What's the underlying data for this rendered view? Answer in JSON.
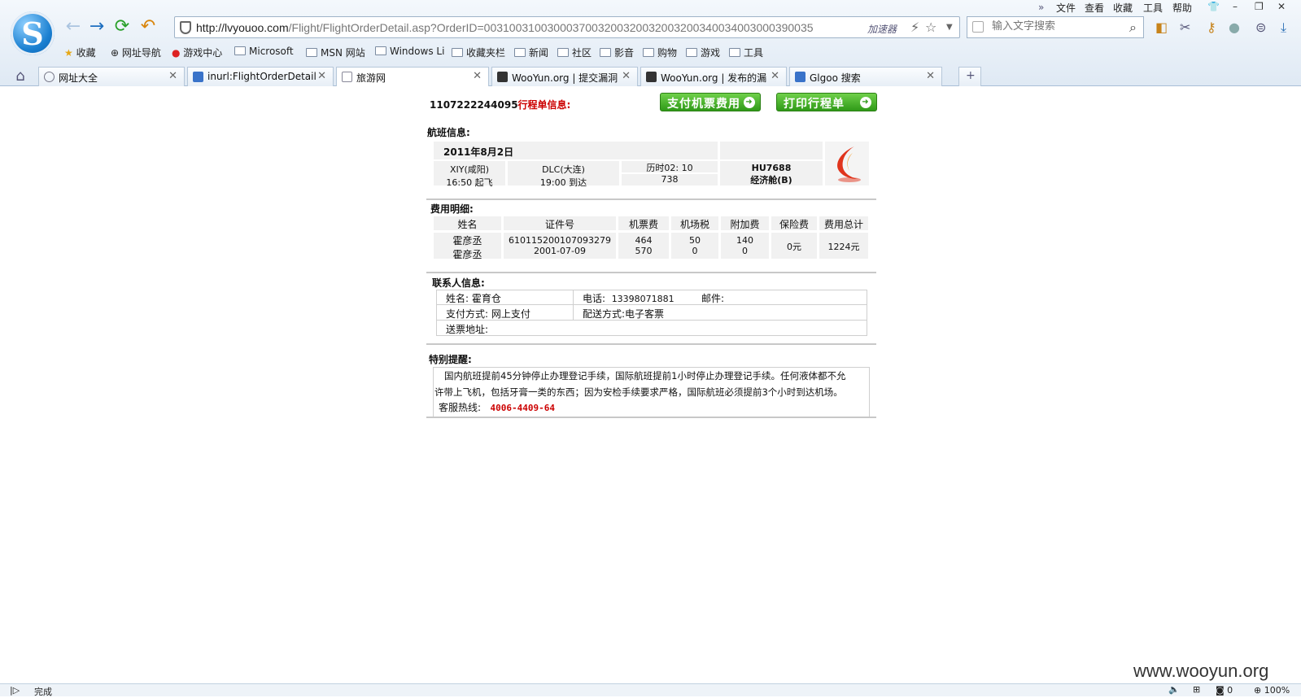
{
  "browser": {
    "url_host": "http://lvyouoo.com",
    "url_rest": "/Flight/FlightOrderDetail.asp?OrderID=0031003100300037003200320032003200340034003000390035",
    "accelerator": "加速器",
    "search_placeholder": "输入文字搜索",
    "menu": [
      "文件",
      "查看",
      "收藏",
      "工具",
      "帮助"
    ],
    "favorites": [
      "收藏",
      "网址导航",
      "游戏中心",
      "Microsoft",
      "MSN 网站",
      "Windows Li",
      "收藏夹栏",
      "新闻",
      "社区",
      "影音",
      "购物",
      "游戏",
      "工具"
    ],
    "tabs": [
      "网址大全",
      "inurl:FlightOrderDetail.",
      "旅游网",
      "WooYun.org | 提交漏洞",
      "WooYun.org | 发布的漏",
      "Glgoo 搜索"
    ],
    "new_tab": "+"
  },
  "order": {
    "number": "1107222244095",
    "title": "行程单信息:",
    "pay_button": "支付机票费用",
    "print_button": "打印行程单"
  },
  "flight": {
    "section": "航班信息:",
    "date": "2011年8月2日",
    "from_city": "XIY(咸阳)",
    "depart": "16:50 起飞",
    "to_city": "DLC(大连)",
    "arrive": "19:00 到达",
    "duration": "历时02: 10",
    "code": "738",
    "flight_no": "HU7688",
    "cabin": "经济舱(B)"
  },
  "fees": {
    "section": "费用明细:",
    "headers": [
      "姓名",
      "证件号",
      "机票费",
      "机场税",
      "附加费",
      "保险费",
      "费用总计"
    ],
    "rows": [
      [
        "霍彦丞",
        "610115200107093279",
        "464",
        "50",
        "140"
      ],
      [
        "霍彦丞",
        "2001-07-09",
        "570",
        "0",
        "0"
      ]
    ],
    "insurance": "0元",
    "total": "1224元"
  },
  "contact": {
    "section": "联系人信息:",
    "name_label": "姓名:",
    "name": "霍育仓",
    "phone_label": "电话:",
    "phone": "13398071881",
    "email_label": "邮件:",
    "pay_label": "支付方式:",
    "pay": "网上支付",
    "delivery_label": "配送方式:",
    "delivery": "电子客票",
    "address_label": "送票地址:"
  },
  "notice": {
    "section": "特别提醒:",
    "line1": "国内航班提前45分钟停止办理登记手续，国际航班提前1小时停止办理登记手续。任何液体都不允",
    "line2": "许带上飞机，包括牙膏一类的东西；因为安检手续要求严格，国际航班必须提前3个小时到达机场。",
    "hotline_label": "客服热线:",
    "hotline": "4006-4409-64"
  },
  "status": {
    "text": "完成",
    "count": "0",
    "zoom": "100%"
  },
  "watermark": "www.wooyun.org",
  "colors": {
    "accent_red": "#cc0000",
    "button_green": "#2f9a18"
  }
}
